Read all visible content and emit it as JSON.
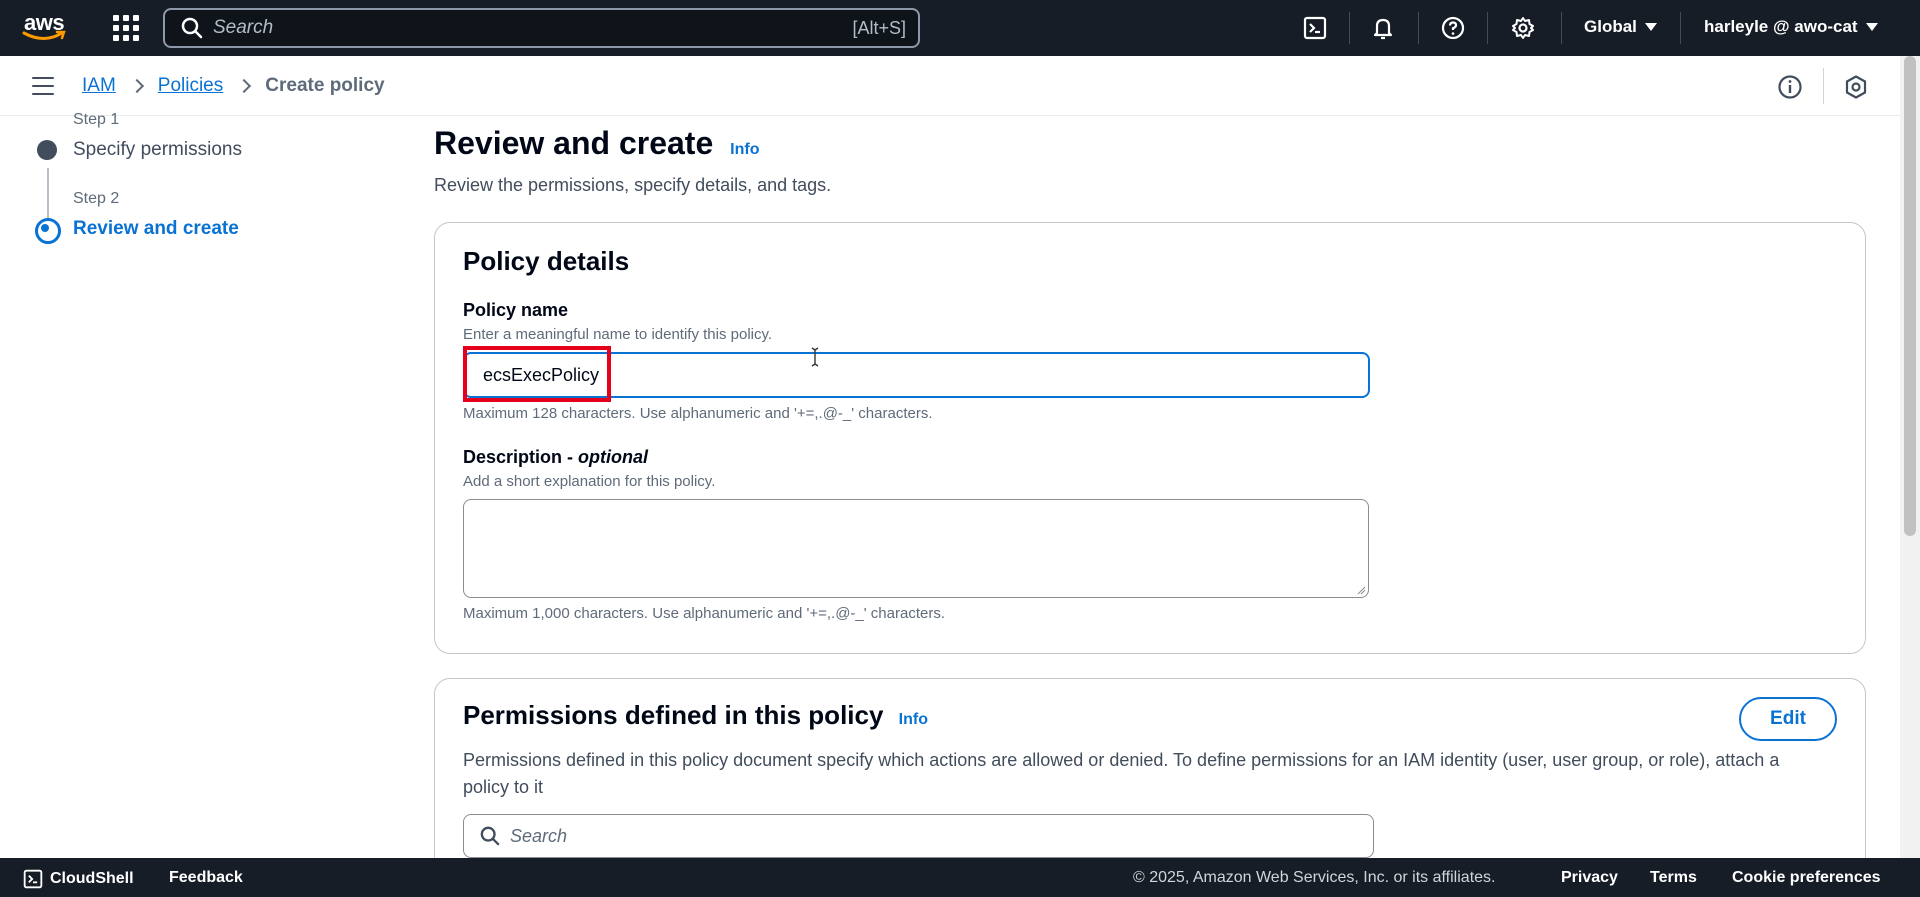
{
  "topnav": {
    "logo_text": "aws",
    "search_placeholder": "Search",
    "search_shortcut": "[Alt+S]",
    "region": "Global",
    "account": "harleyle @ awo-cat",
    "icons": [
      "cloudshell-icon",
      "bell-icon",
      "help-icon",
      "gear-icon"
    ]
  },
  "breadcrumb": {
    "items": [
      "IAM",
      "Policies"
    ],
    "current": "Create policy"
  },
  "steps": [
    {
      "label": "Step 1",
      "title": "Specify permissions",
      "state": "complete"
    },
    {
      "label": "Step 2",
      "title": "Review and create",
      "state": "active"
    }
  ],
  "main": {
    "title": "Review and create",
    "info": "Info",
    "subtitle": "Review the permissions, specify details, and tags."
  },
  "policy_details": {
    "title": "Policy details",
    "name_label": "Policy name",
    "name_desc": "Enter a meaningful name to identify this policy.",
    "name_value": "ecsExecPolicy",
    "name_constraint": "Maximum 128 characters. Use alphanumeric and '+=,.@-_' characters.",
    "desc_label": "Description -",
    "desc_optional": "optional",
    "desc_desc": "Add a short explanation for this policy.",
    "desc_value": "",
    "desc_constraint": "Maximum 1,000 characters. Use alphanumeric and '+=,.@-_' characters."
  },
  "permissions": {
    "title": "Permissions defined in this policy",
    "info": "Info",
    "edit_label": "Edit",
    "description": "Permissions defined in this policy document specify which actions are allowed or denied. To define permissions for an IAM identity (user, user group, or role), attach a policy to it",
    "search_placeholder": "Search"
  },
  "footer": {
    "cloudshell": "CloudShell",
    "feedback": "Feedback",
    "copyright": "© 2025, Amazon Web Services, Inc. or its affiliates.",
    "privacy": "Privacy",
    "terms": "Terms",
    "cookie": "Cookie preferences"
  },
  "colors": {
    "nav_bg": "#161d26",
    "link": "#0972d3",
    "highlight": "#e5001c"
  }
}
